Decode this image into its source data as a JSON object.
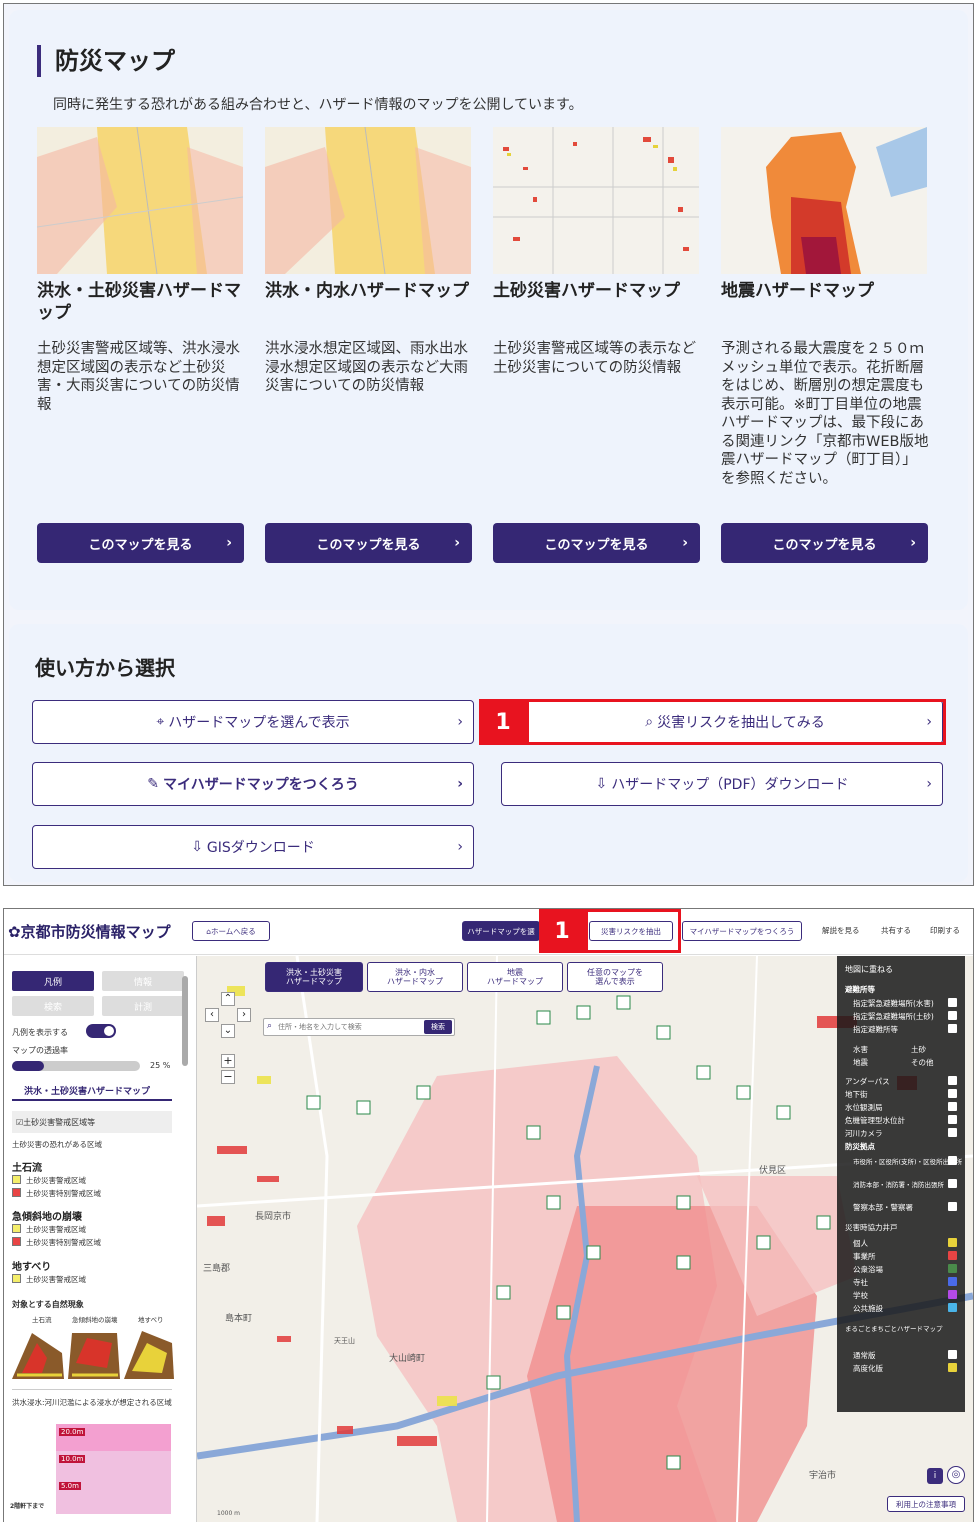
{
  "top": {
    "title": "防災マップ",
    "description": "同時に発生する恐れがある組み合わせと、ハザード情報のマップを公開しています。",
    "cards": [
      {
        "title": "洪水・土砂災害ハザードマップ",
        "desc": "土砂災害警戒区域等、洪水浸水想定区域図の表示など土砂災害・大雨災害についての防災情報",
        "button": "このマップを見る"
      },
      {
        "title": "洪水・内水ハザードマップ",
        "desc": "洪水浸水想定区域図、雨水出水浸水想定区域図の表示など大雨災害についての防災情報",
        "button": "このマップを見る"
      },
      {
        "title": "土砂災害ハザードマップ",
        "desc": "土砂災害警戒区域等の表示など土砂災害についての防災情報",
        "button": "このマップを見る"
      },
      {
        "title": "地震ハザードマップ",
        "desc": "予測される最大震度を２５０ｍメッシュ単位で表示。花折断層をはじめ、断層別の想定震度も表示可能。※町丁目単位の地震ハザードマップは、最下段にある関連リンク「京都市WEB版地震ハザードマップ（町丁目）」を参照ください。",
        "button": "このマップを見る"
      }
    ]
  },
  "usage": {
    "title": "使い方から選択",
    "buttons": {
      "select_map": "ハザードマップを選んで表示",
      "extract_risk": "災害リスクを抽出してみる",
      "my_map": "マイハザードマップをつくろう",
      "pdf": "ハザードマップ（PDF）ダウンロード",
      "gis": "GISダウンロード"
    },
    "marker": "1"
  },
  "app": {
    "logo": "京都市防災情報マップ",
    "home": "ホームへ戻る",
    "hazard_select": "ハザードマップを選",
    "extract": "災害リスクを抽出",
    "my_map": "マイハザードマップをつくろう",
    "help": "解説を見る",
    "share": "共有する",
    "print": "印刷する",
    "marker": "1",
    "legend": {
      "tabs": [
        "凡例",
        "情報",
        "検索",
        "計測"
      ],
      "show_legend": "凡例を表示する",
      "opacity_label": "マップの透過率",
      "opacity_value": "25 %",
      "opacity_level": 0.25,
      "map_name": "洪水・土砂災害ハザードマップ",
      "checkbox": "土砂災害警戒区域等",
      "sub": "土砂災害の恐れがある区域",
      "groups": [
        {
          "name": "土石流",
          "items": [
            "土砂災害警戒区域",
            "土砂災害特別警戒区域"
          ]
        },
        {
          "name": "急傾斜地の崩壊",
          "items": [
            "土砂災害警戒区域",
            "土砂災害特別警戒区域"
          ]
        },
        {
          "name": "地すべり",
          "items": [
            "土砂災害警戒区域"
          ]
        }
      ],
      "phenomena_title": "対象とする自然現象",
      "phenomena": [
        "土石流",
        "急傾斜地の崩壊",
        "地すべり"
      ],
      "flood_text": "洪水浸水:河川氾濫による浸水が想定される区域",
      "depths": [
        "20.0m",
        "10.0m",
        "5.0m"
      ],
      "depth_note": "2階軒下まで"
    },
    "map": {
      "tabs": [
        "洪水・土砂災害\nハザードマップ",
        "洪水・内水\nハザードマップ",
        "地震\nハザードマップ",
        "任意のマップを\n選んで表示"
      ],
      "search_placeholder": "住所・地名を入力して検索",
      "search_button": "検索",
      "labels": [
        "長岡京市",
        "伏見区",
        "宇治市",
        "大山崎町",
        "天王山",
        "島本町",
        "三島郡"
      ],
      "scale": "1000 m",
      "terms": "利用上の注意事項"
    },
    "overlay": {
      "title": "地図に重ねる",
      "items": [
        "避難所等",
        "指定緊急避難場所(水害)",
        "指定緊急避難場所(土砂)",
        "指定避難所等",
        "水害",
        "土砂",
        "地震",
        "その他",
        "アンダーパス",
        "地下街",
        "水位観測局",
        "危機管理型水位計",
        "河川カメラ",
        "防災拠点",
        "市役所・区役所(支所)・区役所出張所",
        "消防本部・消防署・消防出張所",
        "警察本部・警察署",
        "災害時協力井戸",
        "個人",
        "事業所",
        "公衆浴場",
        "寺社",
        "学校",
        "公共施設",
        "まるごとまちごとハザードマップ",
        "通常版",
        "高度化版"
      ]
    },
    "colors": {
      "accent": "#352774",
      "red": "#e8131f"
    }
  }
}
